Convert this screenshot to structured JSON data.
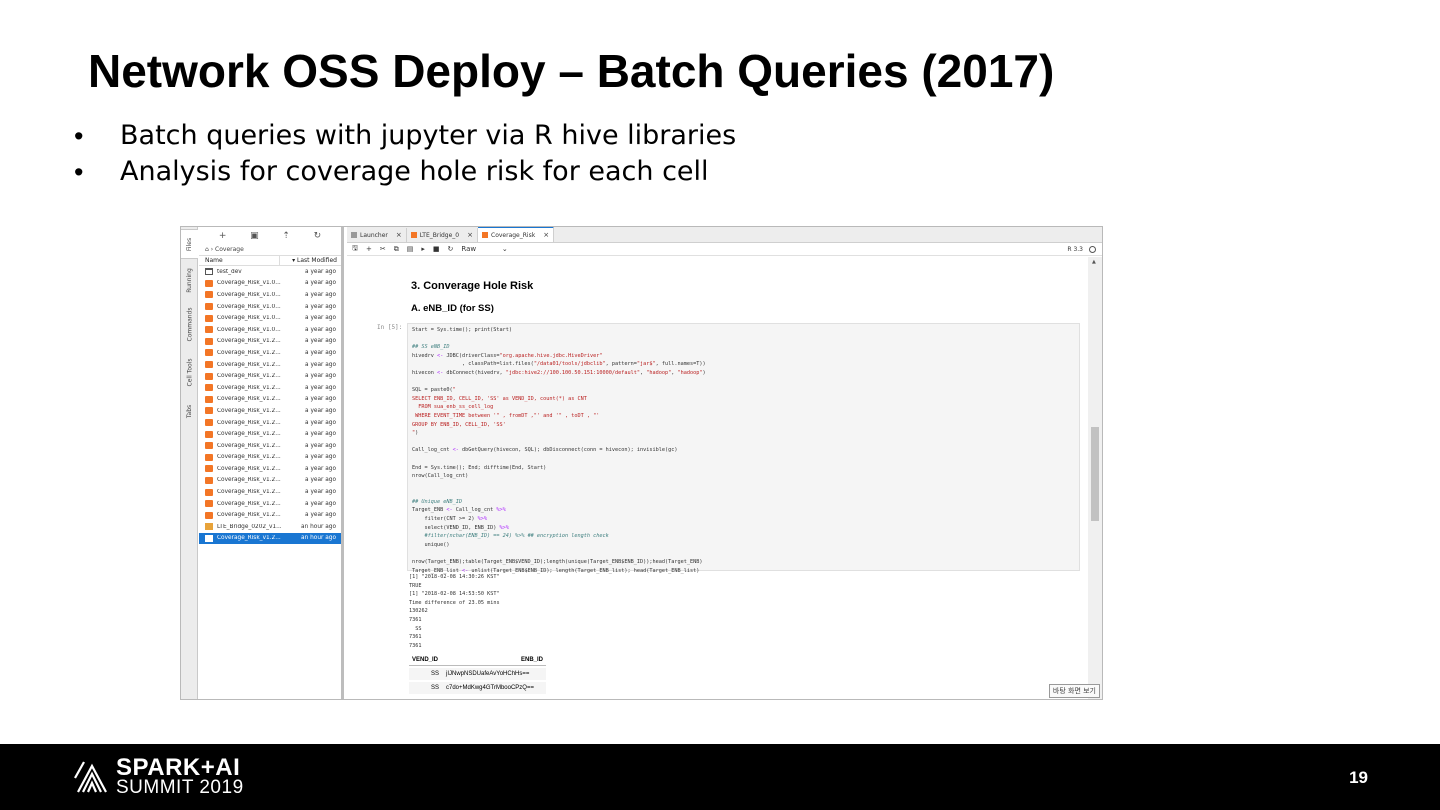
{
  "slide": {
    "title": "Network OSS Deploy – Batch Queries (2017)",
    "bullets": [
      "Batch queries with jupyter via R hive libraries",
      "Analysis for coverage hole risk for each cell"
    ],
    "page_number": "19"
  },
  "footer": {
    "logo_line1": "SPARK+AI",
    "logo_line2": "SUMMIT 2019"
  },
  "jupyter": {
    "side_tabs": [
      "Files",
      "Running",
      "Commands",
      "Cell Tools",
      "Tabs"
    ],
    "filebrowser": {
      "toolbar_icons": [
        "new-launcher-icon",
        "new-folder-icon",
        "upload-icon",
        "refresh-icon"
      ],
      "breadcrumb": "Coverage",
      "col_name": "Name",
      "col_modified": "Last Modified",
      "files": [
        {
          "name": "test_dev",
          "modified": "a year ago",
          "type": "folder"
        },
        {
          "name": "Coverage_Risk_v1.0...",
          "modified": "a year ago",
          "type": "notebook"
        },
        {
          "name": "Coverage_Risk_v1.0...",
          "modified": "a year ago",
          "type": "notebook"
        },
        {
          "name": "Coverage_Risk_v1.0...",
          "modified": "a year ago",
          "type": "notebook"
        },
        {
          "name": "Coverage_Risk_v1.0...",
          "modified": "a year ago",
          "type": "notebook"
        },
        {
          "name": "Coverage_Risk_v1.0...",
          "modified": "a year ago",
          "type": "notebook"
        },
        {
          "name": "Coverage_Risk_v1.2...",
          "modified": "a year ago",
          "type": "notebook"
        },
        {
          "name": "Coverage_Risk_v1.2...",
          "modified": "a year ago",
          "type": "notebook"
        },
        {
          "name": "Coverage_Risk_v1.2...",
          "modified": "a year ago",
          "type": "notebook"
        },
        {
          "name": "Coverage_Risk_v1.2...",
          "modified": "a year ago",
          "type": "notebook"
        },
        {
          "name": "Coverage_Risk_v1.2...",
          "modified": "a year ago",
          "type": "notebook"
        },
        {
          "name": "Coverage_Risk_v1.2...",
          "modified": "a year ago",
          "type": "notebook"
        },
        {
          "name": "Coverage_Risk_v1.2...",
          "modified": "a year ago",
          "type": "notebook"
        },
        {
          "name": "Coverage_Risk_v1.2...",
          "modified": "a year ago",
          "type": "notebook"
        },
        {
          "name": "Coverage_Risk_v1.2...",
          "modified": "a year ago",
          "type": "notebook"
        },
        {
          "name": "Coverage_Risk_v1.2...",
          "modified": "a year ago",
          "type": "notebook"
        },
        {
          "name": "Coverage_Risk_v1.2...",
          "modified": "a year ago",
          "type": "notebook"
        },
        {
          "name": "Coverage_Risk_v1.2...",
          "modified": "a year ago",
          "type": "notebook"
        },
        {
          "name": "Coverage_Risk_v1.2...",
          "modified": "a year ago",
          "type": "notebook"
        },
        {
          "name": "Coverage_Risk_v1.2...",
          "modified": "a year ago",
          "type": "notebook"
        },
        {
          "name": "Coverage_Risk_v1.2...",
          "modified": "a year ago",
          "type": "notebook"
        },
        {
          "name": "Coverage_Risk_v1.2...",
          "modified": "a year ago",
          "type": "notebook"
        },
        {
          "name": "LTE_Bridge_0202_v1...",
          "modified": "an hour ago",
          "type": "launcher"
        },
        {
          "name": "Coverage_Risk_v1.2...",
          "modified": "an hour ago",
          "type": "notebook-selected"
        }
      ]
    },
    "tabs": [
      {
        "label": "Launcher",
        "icon": "launcher-icon"
      },
      {
        "label": "LTE_Bridge_0",
        "icon": "notebook-icon"
      },
      {
        "label": "Coverage_Risk",
        "icon": "notebook-icon"
      }
    ],
    "toolbar": {
      "cell_type": "Raw",
      "kernel": "R 3.3"
    },
    "notebook": {
      "heading3": "3. Converage Hole Risk",
      "heading4": "A. eNB_ID (for SS)",
      "prompt": "In [5]:",
      "output_lines": [
        "[1] \"2018-02-08 14:30:26 KST\"",
        "TRUE",
        "[1] \"2018-02-08 14:53:50 KST\"",
        "Time difference of 23.05 mins",
        "130262",
        "7361",
        "  SS",
        "7361",
        "7361"
      ],
      "table": {
        "headers": [
          "VEND_ID",
          "ENB_ID"
        ],
        "rows": [
          [
            "SS",
            "jIJNwpNSDUafeAvYoHChHs=="
          ],
          [
            "SS",
            "c7do+MdKwg4GTrMbooCPzQ=="
          ]
        ]
      }
    },
    "ime_badge": "바탕 화면 보기"
  }
}
